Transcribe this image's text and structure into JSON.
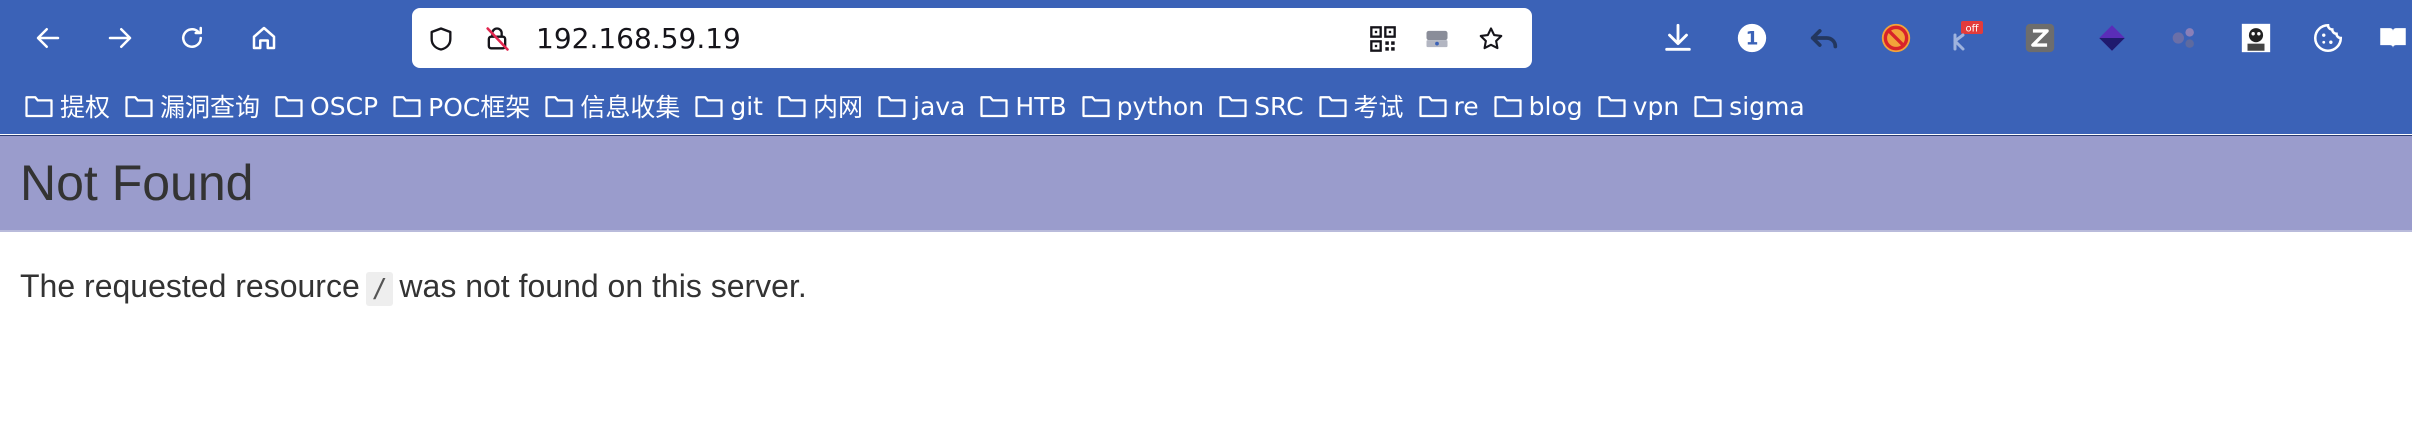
{
  "browser": {
    "url": "192.168.59.19",
    "toolbar": {
      "badge_count": "1",
      "off_badge": "off"
    },
    "bookmarks": [
      {
        "label": "提权"
      },
      {
        "label": "漏洞查询"
      },
      {
        "label": "OSCP"
      },
      {
        "label": "POC框架"
      },
      {
        "label": "信息收集"
      },
      {
        "label": "git"
      },
      {
        "label": "内网"
      },
      {
        "label": "java"
      },
      {
        "label": "HTB"
      },
      {
        "label": "python"
      },
      {
        "label": "SRC"
      },
      {
        "label": "考试"
      },
      {
        "label": "re"
      },
      {
        "label": "blog"
      },
      {
        "label": "vpn"
      },
      {
        "label": "sigma"
      }
    ]
  },
  "page": {
    "title": "Not Found",
    "message_before": "The requested resource",
    "message_code": "/",
    "message_after": "was not found on this server."
  },
  "colors": {
    "chrome": "#3b62b7",
    "header_band": "#9a9ccc"
  }
}
